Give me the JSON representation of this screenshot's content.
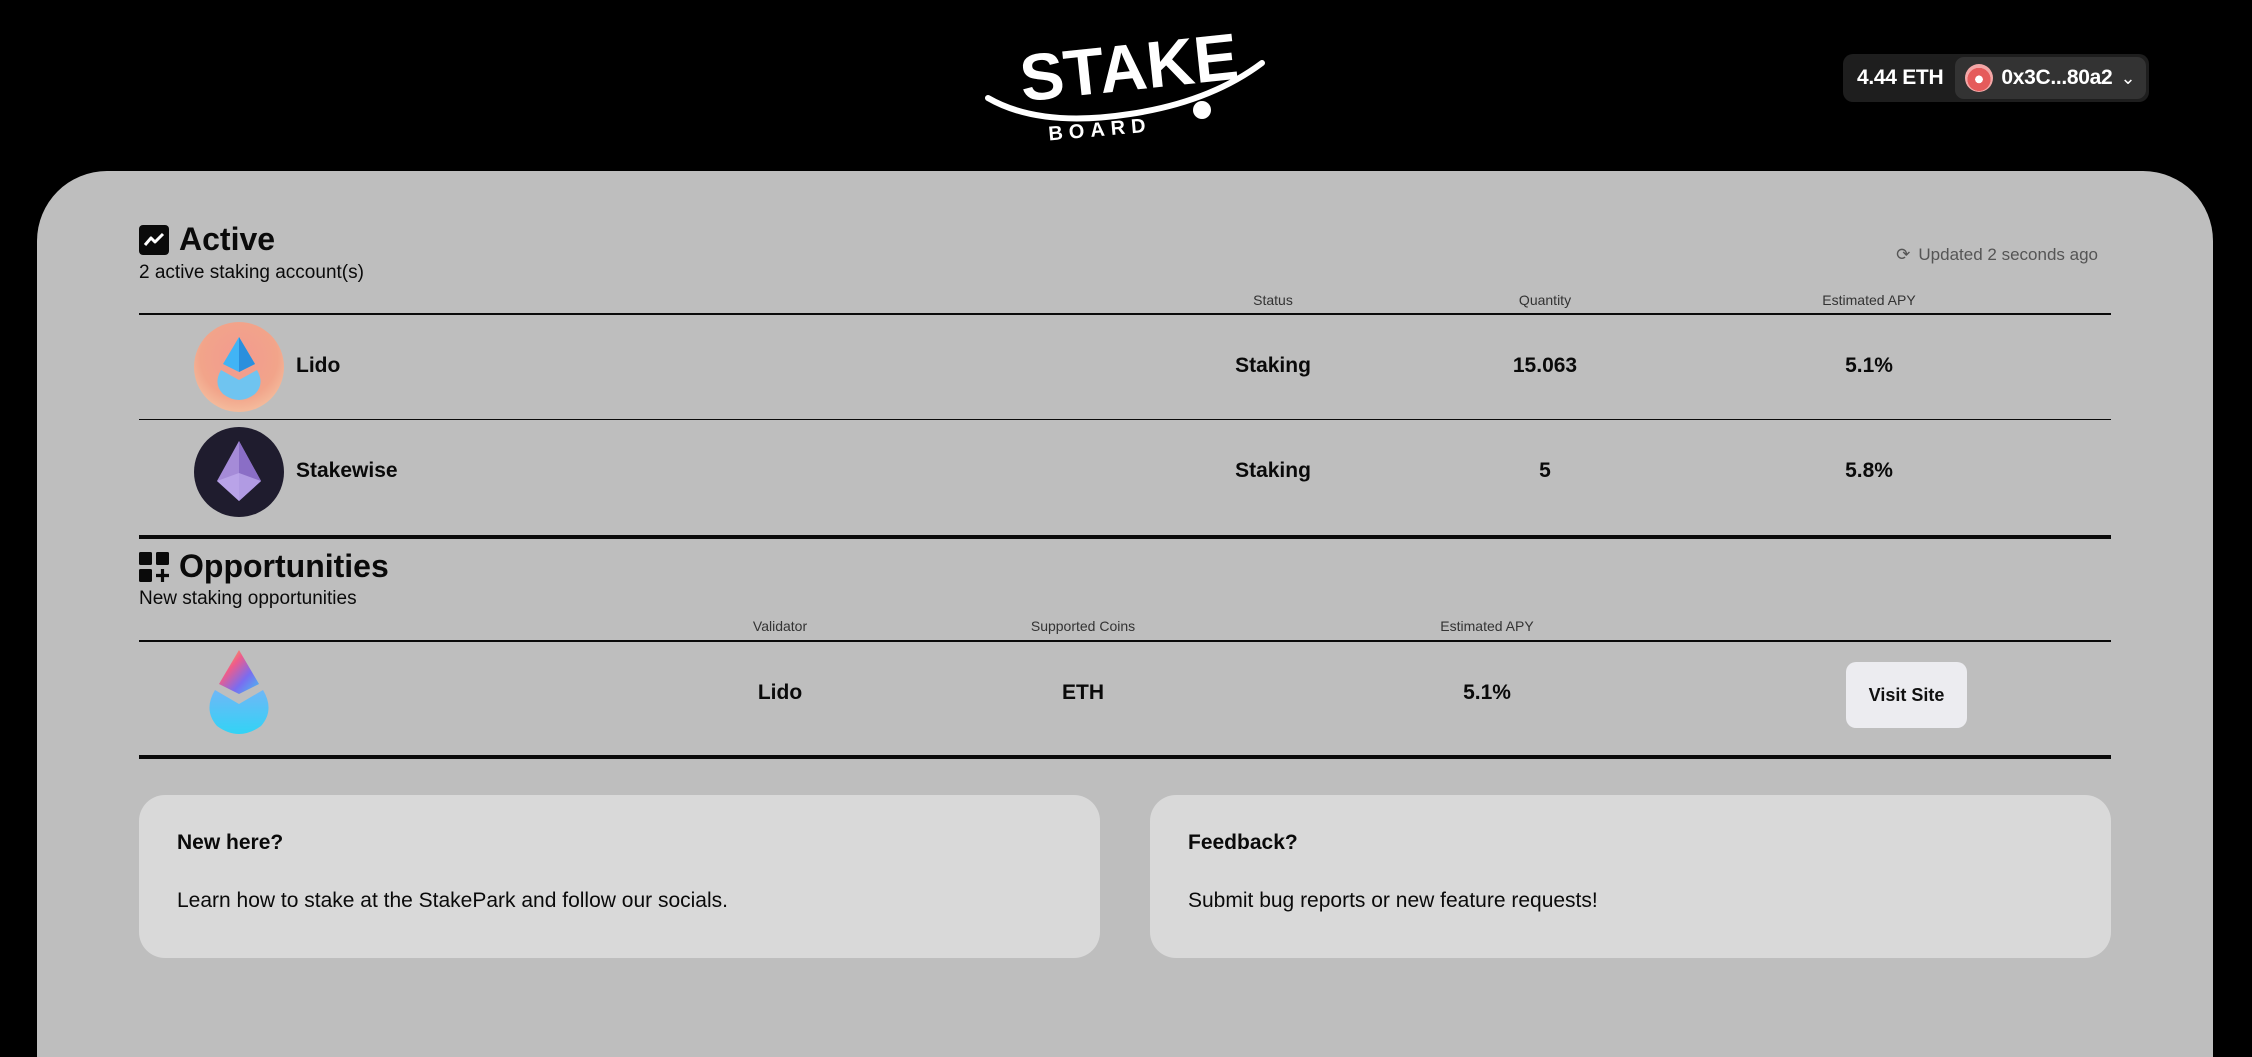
{
  "header": {
    "logo_text_main": "STAKE",
    "logo_text_sub": "BOARD",
    "balance": "4.44 ETH",
    "address": "0x3C...80a2",
    "chevron_icon": "chevron-down-icon"
  },
  "active": {
    "title": "Active",
    "subtitle": "2 active staking account(s)",
    "updated": "Updated 2 seconds ago",
    "columns": {
      "status": "Status",
      "quantity": "Quantity",
      "apy": "Estimated APY"
    },
    "rows": [
      {
        "name": "Lido",
        "status": "Staking",
        "quantity": "15.063",
        "apy": "5.1%"
      },
      {
        "name": "Stakewise",
        "status": "Staking",
        "quantity": "5",
        "apy": "5.8%"
      }
    ]
  },
  "opportunities": {
    "title": "Opportunities",
    "subtitle": "New staking opportunities",
    "columns": {
      "validator": "Validator",
      "coins": "Supported Coins",
      "apy": "Estimated APY"
    },
    "rows": [
      {
        "validator": "Lido",
        "coins": "ETH",
        "apy": "5.1%",
        "action": "Visit Site"
      }
    ]
  },
  "cards": [
    {
      "title": "New here?",
      "desc": "Learn how to stake at the StakePark and follow our socials."
    },
    {
      "title": "Feedback?",
      "desc": "Submit bug reports or new feature requests!"
    }
  ],
  "colors": {
    "background": "#000000",
    "panel": "#bebebe",
    "card": "#d9d9d9",
    "button": "#ececf0"
  }
}
